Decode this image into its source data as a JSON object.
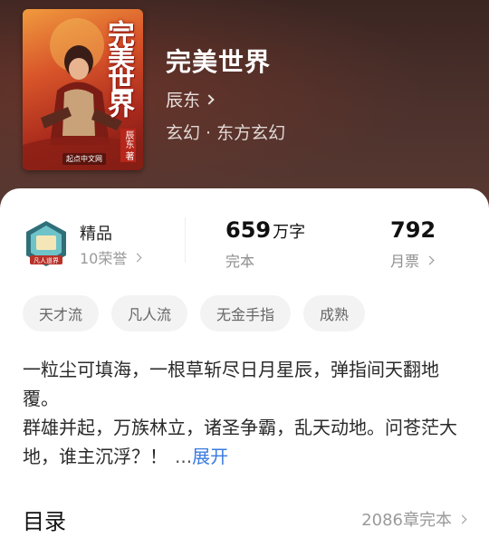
{
  "book": {
    "title": "完美世界",
    "author": "辰东",
    "genre": "玄幻 · 东方玄幻"
  },
  "cover": {
    "title_art": "完美世界",
    "author_tag": "辰东 著",
    "publisher_logo": "起点中文网"
  },
  "honor": {
    "title": "精品",
    "count": "10荣誉",
    "badge_text": "凡人道界"
  },
  "stats": {
    "words_value": "659",
    "words_unit": "万字",
    "words_label": "完本",
    "votes_value": "792",
    "votes_label": "月票"
  },
  "tags": [
    "天才流",
    "凡人流",
    "无金手指",
    "成熟"
  ],
  "synopsis": {
    "line1": "一粒尘可填海，一根草斩尽日月星辰，弹指间天翻地覆。",
    "line2": "群雄并起，万族林立，诸圣争霸，乱天动地。问苍茫大地，谁主沉浮？！",
    "ellipsis": "...",
    "more": "展开"
  },
  "toc": {
    "title": "目录",
    "info": "2086章完本"
  },
  "colors": {
    "accent_link": "#3a7be0",
    "hero_bg": "#3b2622"
  }
}
